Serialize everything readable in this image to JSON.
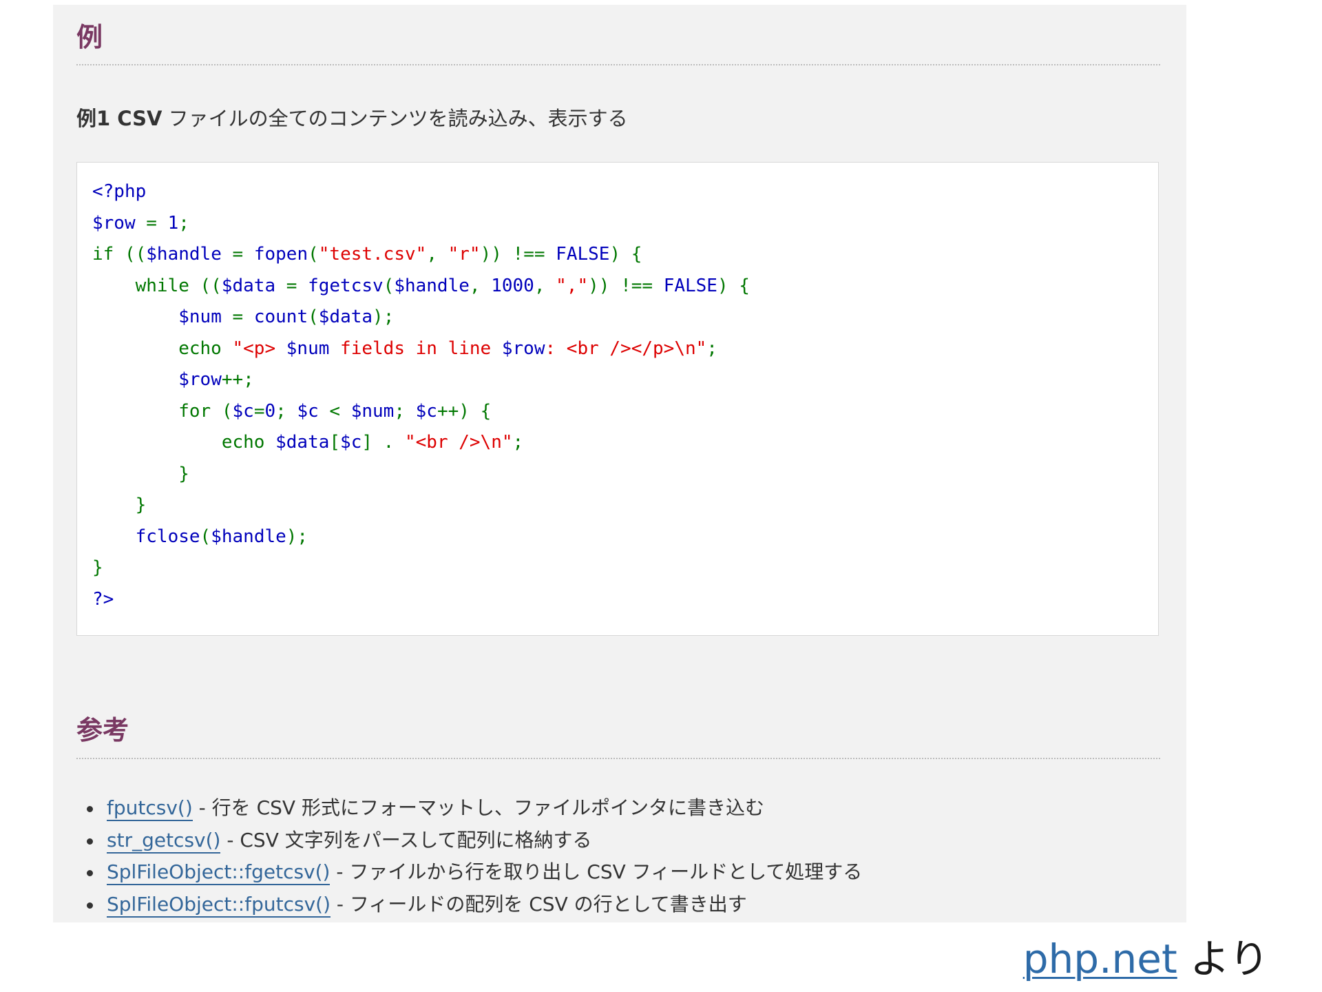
{
  "sections": {
    "examples_heading": "例",
    "example_title_prefix": "例1",
    "example_title_bold": " CSV",
    "example_title_rest": " ファイルの全てのコンテンツを読み込み、表示する",
    "seealso_heading": "参考"
  },
  "code": {
    "lines": [
      [
        {
          "t": "<?php",
          "c": "default"
        }
      ],
      [
        {
          "t": "$row ",
          "c": "default"
        },
        {
          "t": "= ",
          "c": "keyword"
        },
        {
          "t": "1",
          "c": "default"
        },
        {
          "t": ";",
          "c": "keyword"
        }
      ],
      [
        {
          "t": "if ((",
          "c": "keyword"
        },
        {
          "t": "$handle ",
          "c": "default"
        },
        {
          "t": "= ",
          "c": "keyword"
        },
        {
          "t": "fopen",
          "c": "default"
        },
        {
          "t": "(",
          "c": "keyword"
        },
        {
          "t": "\"test.csv\"",
          "c": "string"
        },
        {
          "t": ", ",
          "c": "keyword"
        },
        {
          "t": "\"r\"",
          "c": "string"
        },
        {
          "t": ")) !== ",
          "c": "keyword"
        },
        {
          "t": "FALSE",
          "c": "default"
        },
        {
          "t": ") {",
          "c": "keyword"
        }
      ],
      [
        {
          "t": "    while ((",
          "c": "keyword"
        },
        {
          "t": "$data ",
          "c": "default"
        },
        {
          "t": "= ",
          "c": "keyword"
        },
        {
          "t": "fgetcsv",
          "c": "default"
        },
        {
          "t": "(",
          "c": "keyword"
        },
        {
          "t": "$handle",
          "c": "default"
        },
        {
          "t": ", ",
          "c": "keyword"
        },
        {
          "t": "1000",
          "c": "default"
        },
        {
          "t": ", ",
          "c": "keyword"
        },
        {
          "t": "\",\"",
          "c": "string"
        },
        {
          "t": ")) !== ",
          "c": "keyword"
        },
        {
          "t": "FALSE",
          "c": "default"
        },
        {
          "t": ") {",
          "c": "keyword"
        }
      ],
      [
        {
          "t": "        ",
          "c": "keyword"
        },
        {
          "t": "$num ",
          "c": "default"
        },
        {
          "t": "= ",
          "c": "keyword"
        },
        {
          "t": "count",
          "c": "default"
        },
        {
          "t": "(",
          "c": "keyword"
        },
        {
          "t": "$data",
          "c": "default"
        },
        {
          "t": ");",
          "c": "keyword"
        }
      ],
      [
        {
          "t": "        echo ",
          "c": "keyword"
        },
        {
          "t": "\"<p> ",
          "c": "string"
        },
        {
          "t": "$num",
          "c": "default"
        },
        {
          "t": " fields in line ",
          "c": "string"
        },
        {
          "t": "$row",
          "c": "default"
        },
        {
          "t": ": <br /></p>\\n\"",
          "c": "string"
        },
        {
          "t": ";",
          "c": "keyword"
        }
      ],
      [
        {
          "t": "        ",
          "c": "keyword"
        },
        {
          "t": "$row",
          "c": "default"
        },
        {
          "t": "++;",
          "c": "keyword"
        }
      ],
      [
        {
          "t": "        for (",
          "c": "keyword"
        },
        {
          "t": "$c",
          "c": "default"
        },
        {
          "t": "=",
          "c": "keyword"
        },
        {
          "t": "0",
          "c": "default"
        },
        {
          "t": "; ",
          "c": "keyword"
        },
        {
          "t": "$c ",
          "c": "default"
        },
        {
          "t": "< ",
          "c": "keyword"
        },
        {
          "t": "$num",
          "c": "default"
        },
        {
          "t": "; ",
          "c": "keyword"
        },
        {
          "t": "$c",
          "c": "default"
        },
        {
          "t": "++) {",
          "c": "keyword"
        }
      ],
      [
        {
          "t": "            echo ",
          "c": "keyword"
        },
        {
          "t": "$data",
          "c": "default"
        },
        {
          "t": "[",
          "c": "keyword"
        },
        {
          "t": "$c",
          "c": "default"
        },
        {
          "t": "] . ",
          "c": "keyword"
        },
        {
          "t": "\"<br />\\n\"",
          "c": "string"
        },
        {
          "t": ";",
          "c": "keyword"
        }
      ],
      [
        {
          "t": "        }",
          "c": "keyword"
        }
      ],
      [
        {
          "t": "    }",
          "c": "keyword"
        }
      ],
      [
        {
          "t": "    ",
          "c": "keyword"
        },
        {
          "t": "fclose",
          "c": "default"
        },
        {
          "t": "(",
          "c": "keyword"
        },
        {
          "t": "$handle",
          "c": "default"
        },
        {
          "t": ");",
          "c": "keyword"
        }
      ],
      [
        {
          "t": "}",
          "c": "keyword"
        }
      ],
      [
        {
          "t": "?>",
          "c": "default"
        }
      ]
    ]
  },
  "seealso": {
    "items": [
      {
        "link": "fputcsv()",
        "desc": " - 行を CSV 形式にフォーマットし、ファイルポインタに書き込む"
      },
      {
        "link": "str_getcsv()",
        "desc": " - CSV 文字列をパースして配列に格納する"
      },
      {
        "link": "SplFileObject::fgetcsv()",
        "desc": " - ファイルから行を取り出し CSV フィールドとして処理する"
      },
      {
        "link": "SplFileObject::fputcsv()",
        "desc": " - フィールドの配列を CSV の行として書き出す"
      }
    ]
  },
  "source": {
    "link": "php.net",
    "suffix": " より"
  },
  "colors": {
    "heading": "#793862",
    "code_default": "#0000bb",
    "code_keyword": "#007700",
    "code_string": "#dd0000",
    "link": "#336699"
  }
}
